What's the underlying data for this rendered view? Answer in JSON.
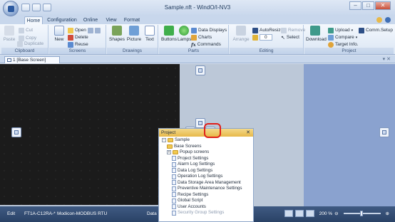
{
  "window": {
    "title": "Sample.nft - WindO/I-NV3"
  },
  "ribbon_tabs": [
    "Home",
    "Configuration",
    "Online",
    "View",
    "Format"
  ],
  "groups": {
    "clipboard": {
      "label": "Clipboard",
      "cut": "Cut",
      "copy": "Copy",
      "paste": "Paste",
      "duplicate": "Duplicate"
    },
    "screens": {
      "label": "Screens",
      "new": "New",
      "open": "Open",
      "delete": "Delete",
      "reuse": "Reuse"
    },
    "drawings": {
      "label": "Drawings",
      "shapes": "Shapes",
      "picture": "Picture",
      "text": "Text"
    },
    "parts": {
      "label": "Parts",
      "buttons": "Buttons",
      "lamps": "Lamps",
      "data_displays": "Data Displays",
      "charts": "Charts",
      "commands": "Commands"
    },
    "editing": {
      "label": "Editing",
      "arrange": "Arrange",
      "autoresize": "AutoResize",
      "remove": "Remove",
      "select": "Select",
      "spin_value": "0"
    },
    "project": {
      "label": "Project",
      "download": "Download",
      "upload": "Upload",
      "compare": "Compare",
      "target_info": "Target Info.",
      "comm_setup": "Comm.Setup"
    }
  },
  "document_tab": {
    "label": "1 [Base Screen]"
  },
  "project_panel": {
    "title": "Project",
    "tree": [
      {
        "label": "Sample",
        "kind": "folder",
        "expander": "−",
        "indent": 0
      },
      {
        "label": "Base Screens",
        "kind": "folder",
        "expander": "",
        "indent": 1
      },
      {
        "label": "Popup screens",
        "kind": "folder",
        "expander": "+",
        "indent": 1
      },
      {
        "label": "Project Settings",
        "kind": "doc",
        "expander": "",
        "indent": 2
      },
      {
        "label": "Alarm Log Settings",
        "kind": "doc",
        "expander": "",
        "indent": 2
      },
      {
        "label": "Data Log Settings",
        "kind": "doc",
        "expander": "",
        "indent": 2
      },
      {
        "label": "Operation Log Settings",
        "kind": "doc",
        "expander": "",
        "indent": 2
      },
      {
        "label": "Data Storage Area Management",
        "kind": "doc",
        "expander": "",
        "indent": 2
      },
      {
        "label": "Preventive Maintenance Settings",
        "kind": "doc",
        "expander": "",
        "indent": 2
      },
      {
        "label": "Recipe Settings",
        "kind": "doc",
        "expander": "",
        "indent": 2
      },
      {
        "label": "Global Script",
        "kind": "doc",
        "expander": "",
        "indent": 2
      },
      {
        "label": "User Accounts",
        "kind": "doc",
        "expander": "",
        "indent": 2
      },
      {
        "label": "Security Group Settings",
        "kind": "doc",
        "expander": "",
        "indent": 2,
        "dim": true
      }
    ]
  },
  "statusbar": {
    "mode": "Edit",
    "model": "FT1A-C12RA-*",
    "protocol": "Modicon-MODBUS RTU",
    "data_label": "Data",
    "zoom": "200 %"
  },
  "colors": {
    "accent": "#e0201a",
    "ribbon": "#dbe6f4",
    "status": "#2a4266",
    "canvas": "#1b1b1b"
  }
}
